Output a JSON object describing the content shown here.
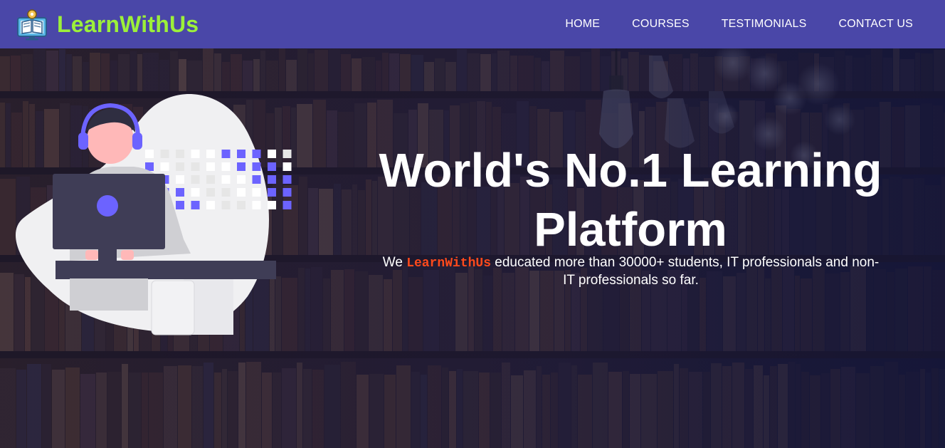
{
  "brand": {
    "name": "LearnWithUs",
    "icon": "online-learning-icon",
    "color": "#9cf03a"
  },
  "nav": {
    "items": [
      {
        "label": "HOME"
      },
      {
        "label": "COURSES"
      },
      {
        "label": "TESTIMONIALS"
      },
      {
        "label": "CONTACT US"
      }
    ]
  },
  "hero": {
    "title": "World's No.1 Learning Platform",
    "subtitle_prefix": "We ",
    "subtitle_brand": "LearnWithUs",
    "subtitle_suffix": " educated more than 30000+ students, IT professionals and non-IT professionals so far.",
    "illustration": "student-at-laptop-illustration"
  },
  "colors": {
    "navbar": "#4a47a8",
    "brand_text": "#9cf03a",
    "inline_brand": "#ff4a1c",
    "accent": "#6c63ff"
  }
}
